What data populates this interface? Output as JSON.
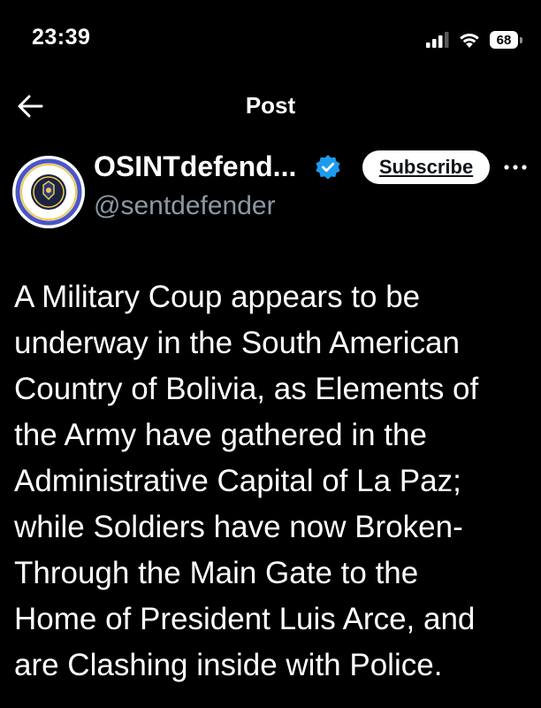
{
  "status_bar": {
    "time": "23:39",
    "battery_level": "68",
    "icons": [
      "signal-icon",
      "wifi-icon",
      "battery-icon"
    ]
  },
  "nav": {
    "back_icon": "arrow-left-icon",
    "title": "Post"
  },
  "author": {
    "display_name": "OSINTdefend...",
    "handle": "@sentdefender",
    "verified": true,
    "avatar_icon": "osint-defender-logo",
    "subscribe_label": "Subscribe",
    "more_icon": "more-horizontal-icon"
  },
  "post": {
    "text": "A Military Coup appears to be\nunderway in the South American\nCountry of Bolivia, as Elements of\nthe Army have gathered in the\nAdministrative Capital of La Paz;\nwhile Soldiers have now Broken-\nThrough the Main Gate to the\nHome of President Luis Arce, and\nare Clashing inside with Police."
  },
  "colors": {
    "background": "#000000",
    "text_primary": "#ffffff",
    "text_secondary": "#8b98a5",
    "verified_blue": "#1d9bf0",
    "subscribe_bg": "#ffffff"
  }
}
